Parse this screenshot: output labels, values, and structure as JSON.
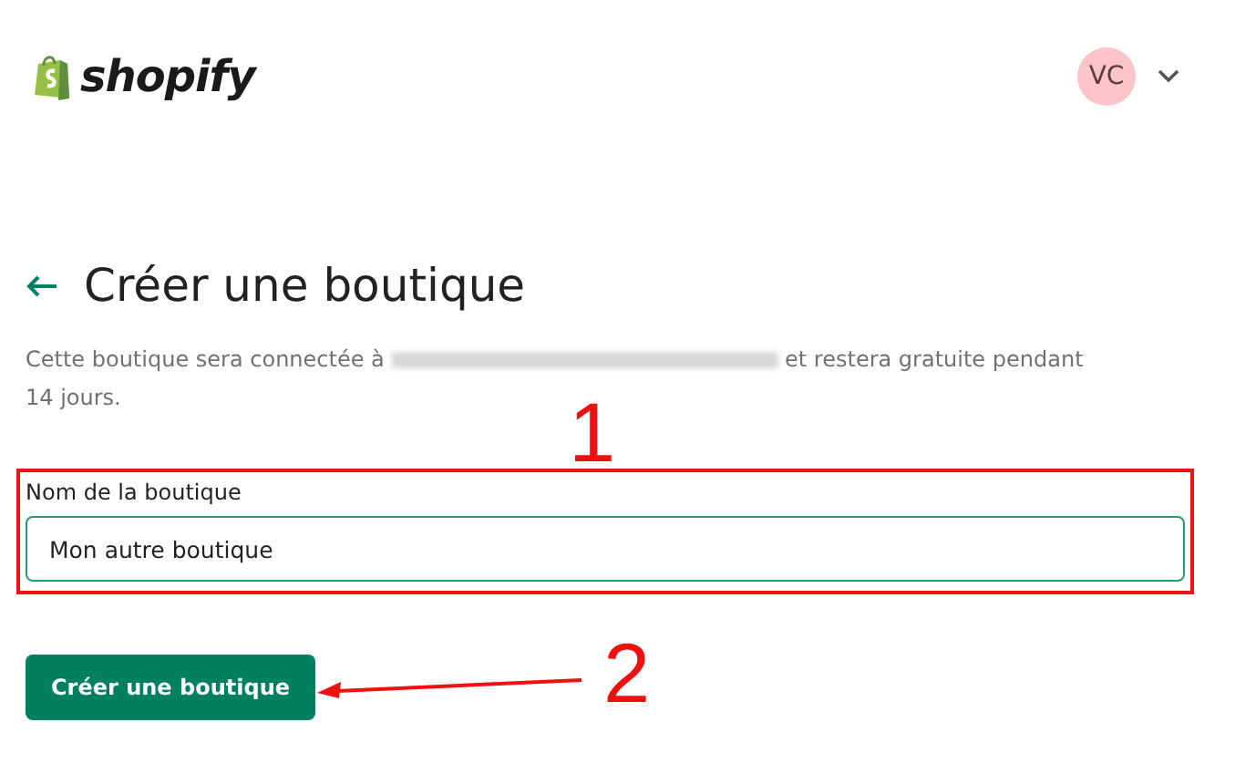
{
  "header": {
    "logo_text": "shopify",
    "avatar_initials": "VC"
  },
  "page": {
    "title": "Créer une boutique",
    "description_before": "Cette boutique sera connectée à",
    "description_after": "et restera gratuite pendant 14 jours."
  },
  "form": {
    "field_label": "Nom de la boutique",
    "field_value": "Mon autre boutique",
    "submit_label": "Créer une boutique"
  },
  "annotations": [
    {
      "label": "1"
    },
    {
      "label": "2"
    }
  ]
}
